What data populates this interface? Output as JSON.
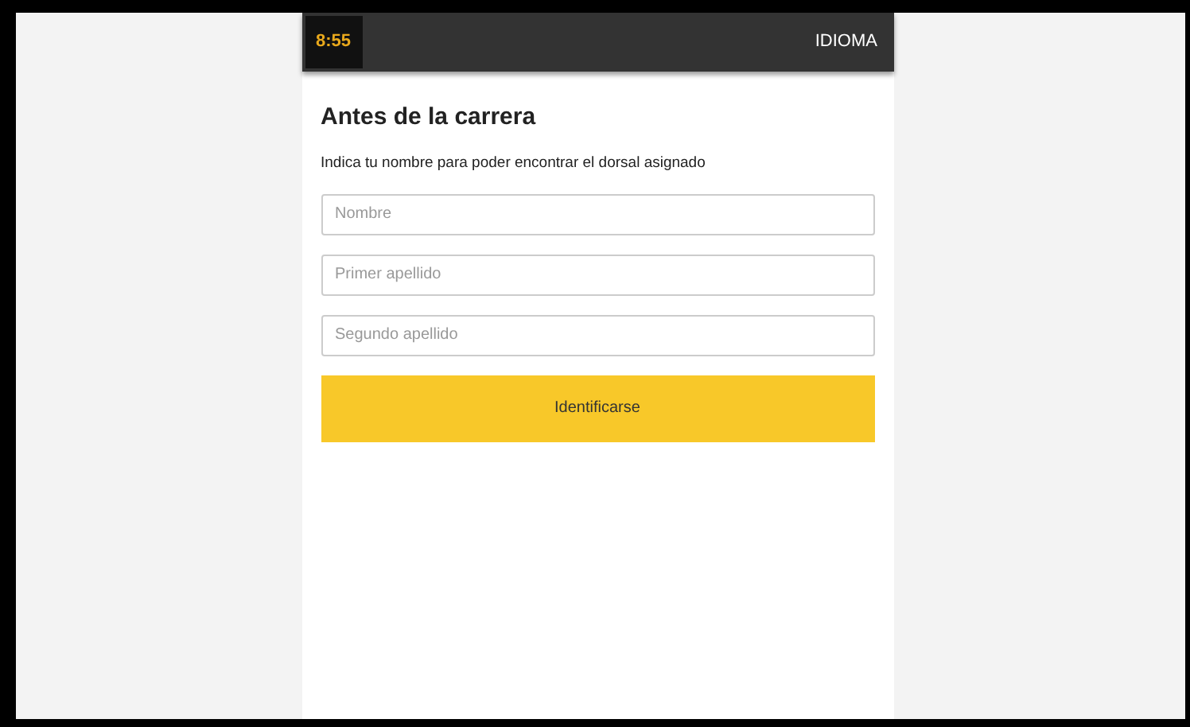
{
  "header": {
    "logo": "8:55",
    "language_button": "IDIOMA"
  },
  "title": "Antes de la carrera",
  "instructions": "Indica tu nombre para poder encontrar el dorsal asignado",
  "fields": [
    {
      "placeholder": "Nombre"
    },
    {
      "placeholder": "Primer apellido"
    },
    {
      "placeholder": "Segundo apellido"
    }
  ],
  "submit_button": "Identificarse"
}
